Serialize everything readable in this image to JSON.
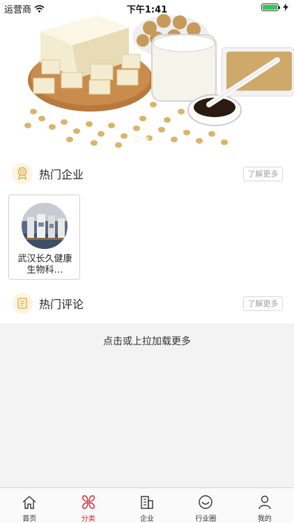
{
  "status_bar": {
    "carrier": "运营商",
    "time": "下午1:41"
  },
  "banner": {
    "slide_count": 3,
    "active_slide": 0
  },
  "hot_companies": {
    "title": "热门企业",
    "more_label": "了解更多",
    "items": [
      {
        "name": "武汉长久健康生物科…"
      }
    ]
  },
  "hot_comments": {
    "title": "热门评论",
    "more_label": "了解更多"
  },
  "load_more": {
    "text": "点击或上拉加载更多"
  },
  "tab_bar": {
    "active_index": 1,
    "accent_color": "#d4262c",
    "items": [
      {
        "label": "首页",
        "icon": "home-icon"
      },
      {
        "label": "分类",
        "icon": "category-icon"
      },
      {
        "label": "企业",
        "icon": "building-icon"
      },
      {
        "label": "行业圈",
        "icon": "smile-circle-icon"
      },
      {
        "label": "我的",
        "icon": "user-icon"
      }
    ]
  }
}
